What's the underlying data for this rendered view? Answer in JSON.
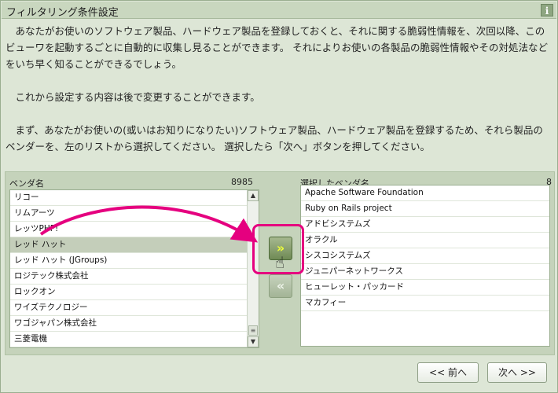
{
  "window": {
    "title": "フィルタリング条件設定",
    "info_icon": "i"
  },
  "description": {
    "paragraph1": "あなたがお使いのソフトウェア製品、ハードウェア製品を登録しておくと、それに関する脆弱性情報を、次回以降、このビューワを起動するごとに自動的に収集し見ることができます。 それによりお使いの各製品の脆弱性情報やその対処法などをいち早く知ることができるでしょう。",
    "paragraph2": "これから設定する内容は後で変更することができます。",
    "paragraph3": "まず、あなたがお使いの(或いはお知りになりたい)ソフトウェア製品、ハードウェア製品を登録するため、それら製品のベンダーを、左のリストから選択してください。 選択したら「次へ」ボタンを押してください。"
  },
  "vendor_list": {
    "label": "ベンダ名",
    "count": "8985",
    "items": [
      "リコー",
      "リムアーツ",
      "レッツPHP!",
      "レッド ハット",
      "レッド ハット (JGroups)",
      "ロジテック株式会社",
      "ロックオン",
      "ワイズテクノロジー",
      "ワゴジャパン株式会社",
      "三菱電機"
    ],
    "selected_index": 3
  },
  "selected_list": {
    "label": "選択したベンダ名",
    "count": "8",
    "items": [
      "Apache Software Foundation",
      "Ruby on Rails project",
      "アドビシステムズ",
      "オラクル",
      "シスコシステムズ",
      "ジュニパーネットワークス",
      "ヒューレット・パッカード",
      "マカフィー"
    ]
  },
  "buttons": {
    "add_label": "»",
    "remove_label": "«",
    "prev_label": "<< 前へ",
    "next_label": "次へ >>"
  },
  "colors": {
    "highlight": "#e5007f",
    "accent": "#6f8a55"
  }
}
